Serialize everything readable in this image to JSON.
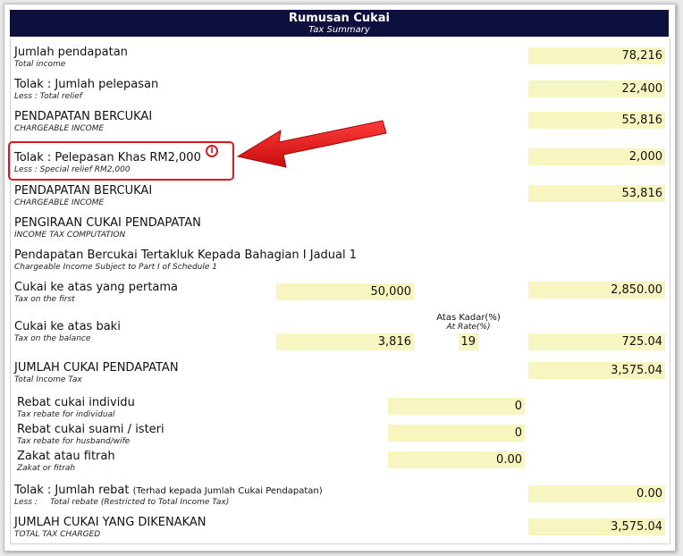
{
  "header": {
    "title": "Rumusan Cukai",
    "subtitle": "Tax Summary"
  },
  "rows": {
    "total_income": {
      "label": "Jumlah pendapatan",
      "sub": "Total income",
      "value": "78,216"
    },
    "total_relief": {
      "label": "Tolak : Jumlah pelepasan",
      "sub": "Less : Total relief",
      "value": "22,400"
    },
    "chargeable_1": {
      "label": "PENDAPATAN BERCUKAI",
      "sub": "CHARGEABLE INCOME",
      "value": "55,816"
    },
    "special_relief": {
      "label": "Tolak : Pelepasan Khas RM2,000",
      "sub": "Less : Special relief RM2,000",
      "value": "2,000"
    },
    "chargeable_2": {
      "label": "PENDAPATAN BERCUKAI",
      "sub": "CHARGEABLE INCOME",
      "value": "53,816"
    },
    "computation": {
      "label": "PENGIRAAN CUKAI PENDAPATAN",
      "sub": "INCOME TAX COMPUTATION"
    },
    "schedule": {
      "label": "Pendapatan Bercukai Tertakluk Kepada Bahagian I Jadual 1",
      "sub": "Chargeable Income Subject to Part I of Schedule 1"
    },
    "tax_first": {
      "label": "Cukai ke atas yang pertama",
      "sub": "Tax on the first",
      "amount": "50,000",
      "value": "2,850.00"
    },
    "tax_balance": {
      "label": "Cukai ke atas baki",
      "sub": "Tax on the balance",
      "amount": "3,816",
      "rate_head": "Atas Kadar(%)",
      "rate_head_sub": "At Rate(%)",
      "rate": "19",
      "value": "725.04"
    },
    "total_tax": {
      "label": "JUMLAH CUKAI PENDAPATAN",
      "sub": "Total Income Tax",
      "value": "3,575.04"
    },
    "rebate_individual": {
      "label": "Rebat cukai individu",
      "sub": "Tax rebate for individual",
      "value": "0"
    },
    "rebate_spouse": {
      "label": "Rebat cukai suami / isteri",
      "sub": "Tax rebate for husband/wife",
      "value": "0"
    },
    "zakat": {
      "label": "Zakat atau fitrah",
      "sub": "Zakat or fitrah",
      "value": "0.00"
    },
    "total_rebate": {
      "label": "Tolak : Jumlah rebat",
      "note": "(Terhad kepada Jumlah Cukai Pendapatan)",
      "sub": "Less :     Total rebate (Restricted to Total Income Tax)",
      "value": "0.00"
    },
    "tax_charged": {
      "label": "JUMLAH CUKAI YANG DIKENAKAN",
      "sub": "TOTAL TAX CHARGED",
      "value": "3,575.04"
    }
  },
  "annotation": {
    "icon": "info-icon",
    "icon_glyph": "i",
    "highlight_color": "#e0161a"
  },
  "colors": {
    "header_bg": "#0d0f3d",
    "field_bg": "#f8f6c0"
  }
}
